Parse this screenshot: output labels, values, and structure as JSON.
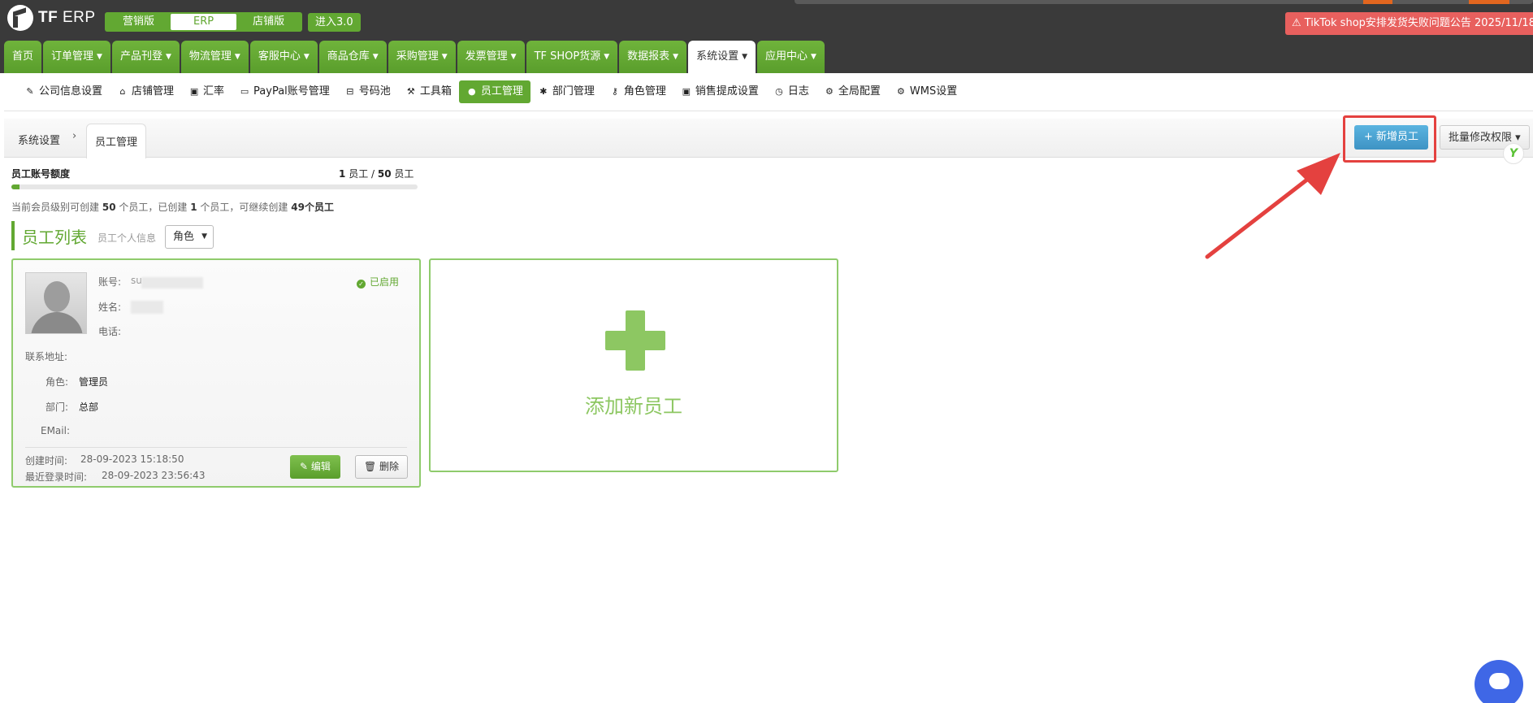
{
  "app": {
    "logo_bold": "TF",
    "logo_light": "ERP"
  },
  "version_switch": [
    "营销版",
    "ERP",
    "店铺版"
  ],
  "enter_button": "进入3.0",
  "notice": {
    "icon": "warning-icon",
    "text": "TikTok shop安排发货失败问题公告 2025/11/18",
    "color": "#e8605e"
  },
  "main_nav": [
    {
      "label": "首页",
      "caret": ""
    },
    {
      "label": "订单管理",
      "caret": "▼"
    },
    {
      "label": "产品刊登",
      "caret": "▼"
    },
    {
      "label": "物流管理",
      "caret": "▼"
    },
    {
      "label": "客服中心",
      "caret": "▼"
    },
    {
      "label": "商品仓库",
      "caret": "▼"
    },
    {
      "label": "采购管理",
      "caret": "▼"
    },
    {
      "label": "发票管理",
      "caret": "▼"
    },
    {
      "label": "TF SHOP货源",
      "caret": "▼"
    },
    {
      "label": "数据报表",
      "caret": "▼"
    },
    {
      "label": "系统设置",
      "caret": "▼"
    },
    {
      "label": "应用中心",
      "caret": "▼"
    }
  ],
  "sub_nav": [
    {
      "label": "公司信息设置",
      "icon": "✎",
      "icon_name": "edit-icon"
    },
    {
      "label": "店铺管理",
      "icon": "⌂",
      "icon_name": "home-icon"
    },
    {
      "label": "汇率",
      "icon": "▣",
      "icon_name": "money-icon"
    },
    {
      "label": "PayPal账号管理",
      "icon": "▭",
      "icon_name": "credit-card-icon"
    },
    {
      "label": "号码池",
      "icon": "⊟",
      "icon_name": "inbox-icon"
    },
    {
      "label": "工具箱",
      "icon": "⚒",
      "icon_name": "wrench-icon"
    },
    {
      "label": "员工管理",
      "icon": "●",
      "icon_name": "user-icon"
    },
    {
      "label": "部门管理",
      "icon": "✱",
      "icon_name": "asterisk-icon"
    },
    {
      "label": "角色管理",
      "icon": "⚷",
      "icon_name": "key-icon"
    },
    {
      "label": "销售提成设置",
      "icon": "▣",
      "icon_name": "money-icon"
    },
    {
      "label": "日志",
      "icon": "◷",
      "icon_name": "clock-icon"
    },
    {
      "label": "全局配置",
      "icon": "⚙",
      "icon_name": "gear-icon"
    },
    {
      "label": "WMS设置",
      "icon": "⚙",
      "icon_name": "gear-icon"
    }
  ],
  "breadcrumb": {
    "root": "系统设置",
    "sep": "›",
    "current": "员工管理"
  },
  "actions": {
    "add_employee": "+ 新增员工",
    "batch_permission": "批量修改权限 ▾",
    "badge": "Y"
  },
  "quota": {
    "title": "员工账号额度",
    "used": "1",
    "used_unit": "员工 /",
    "total": "50",
    "total_unit": "员工",
    "fraction_used": 0.02,
    "desc_1": "当前会员级别可创建",
    "desc_total": "50",
    "desc_2": "个员工，已创建",
    "desc_created": "1",
    "desc_3": "个员工，可继续创建",
    "desc_remaining": "49个员工"
  },
  "section": {
    "title": "员工列表",
    "subtitle": "员工个人信息",
    "role_select": "角色"
  },
  "employee": {
    "status": "已启用",
    "account_label": "账号:",
    "account_value": "su",
    "name_label": "姓名:",
    "phone_label": "电话:",
    "address_label": "联系地址:",
    "role_label": "角色:",
    "role_value": "管理员",
    "dept_label": "部门:",
    "dept_value": "总部",
    "email_label": "EMail:",
    "created_label": "创建时间:",
    "created_value": "28-09-2023 15:18:50",
    "login_label": "最近登录时间:",
    "login_value": "28-09-2023 23:56:43",
    "edit_button": "✎ 编辑",
    "delete_button": "🗑 删除"
  },
  "add_card": {
    "label": "添加新员工"
  },
  "colors": {
    "brand_green": "#62a832",
    "header_bg": "#3a3a3a",
    "add_button": "#4aa3d4",
    "annotation_red": "#e4413f"
  }
}
